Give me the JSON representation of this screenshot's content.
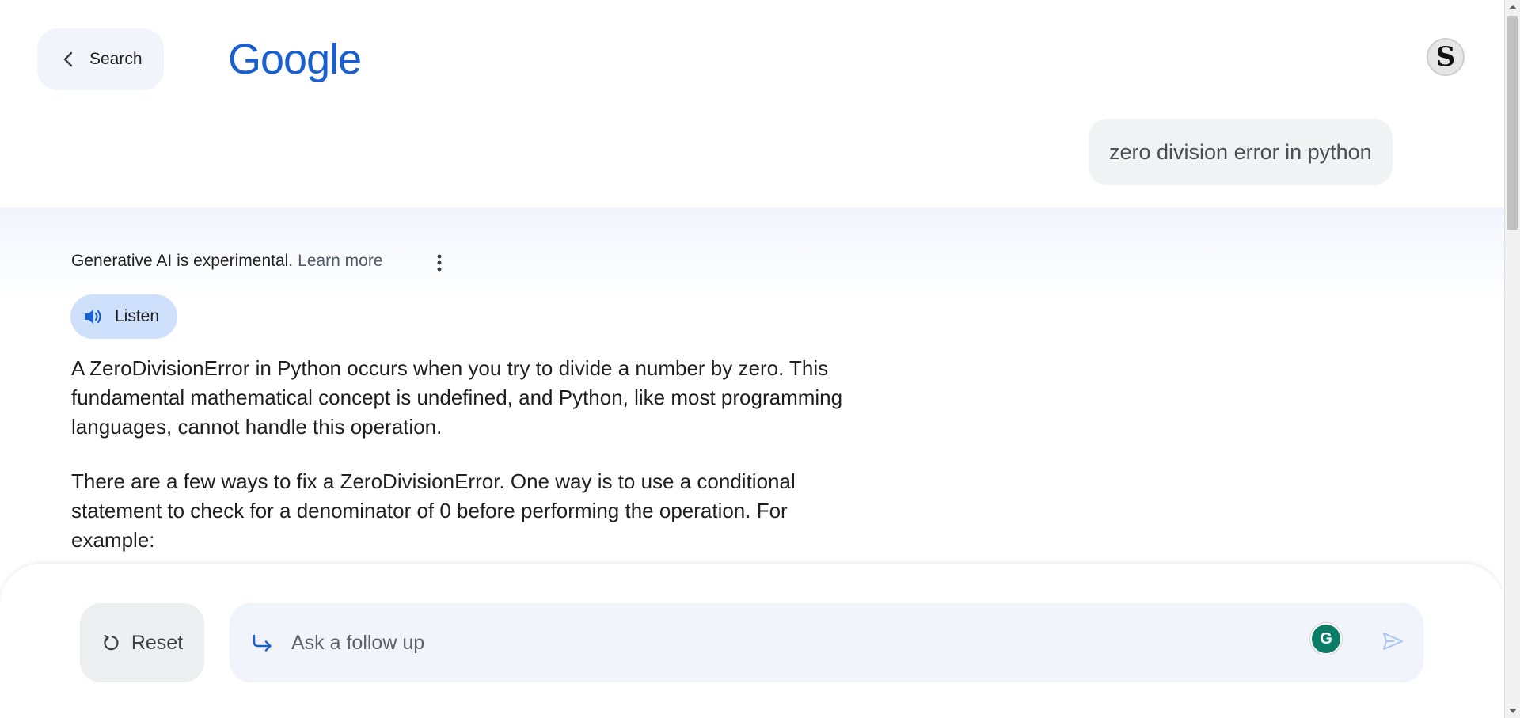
{
  "header": {
    "back_label": "Search",
    "logo_text": "Google",
    "avatar_letter": "S"
  },
  "query": {
    "text": "zero division error in python"
  },
  "answer": {
    "disclaimer": "Generative AI is experimental.",
    "learn_more": "Learn more",
    "listen_label": "Listen",
    "paragraphs": [
      "A ZeroDivisionError in Python occurs when you try to divide a number by zero. This fundamental mathematical concept is undefined, and Python, like most programming languages, cannot handle this operation.",
      "There are a few ways to fix a ZeroDivisionError. One way is to use a conditional statement to check for a denominator of 0 before performing the operation. For example:"
    ]
  },
  "composer": {
    "reset_label": "Reset",
    "followup_placeholder": "Ask a follow up",
    "grammarly_letter": "G"
  },
  "colors": {
    "brand_blue": "#1a5fd0",
    "listen_bg": "#cfe0fc",
    "input_bg": "#f1f4fb"
  },
  "icons": {
    "back": "chevron-left-icon",
    "more": "more-vert-icon",
    "listen": "speaker-icon",
    "reset": "refresh-icon",
    "followup": "subdirectory-arrow-icon",
    "send": "send-icon",
    "grammarly": "grammarly-icon"
  }
}
